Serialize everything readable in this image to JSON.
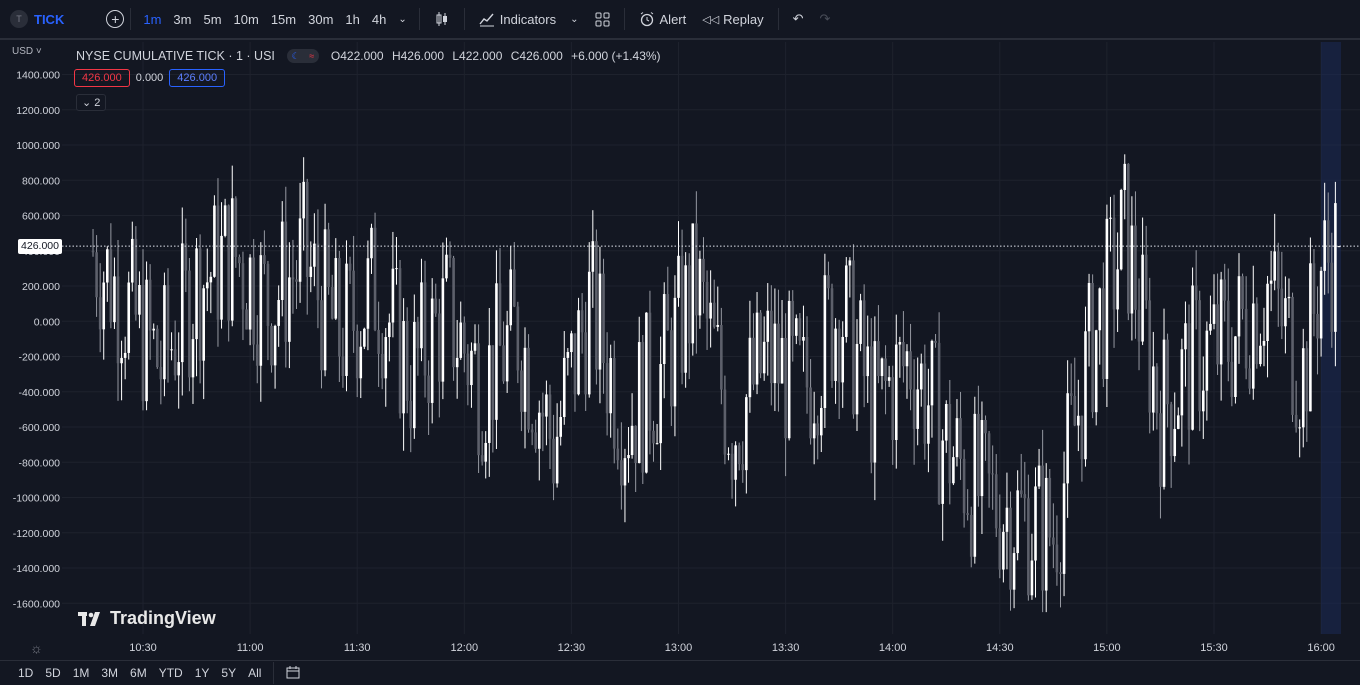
{
  "toolbar": {
    "symbol_badge": "T",
    "symbol": "TICK",
    "intervals": [
      "1m",
      "3m",
      "5m",
      "10m",
      "15m",
      "30m",
      "1h",
      "4h"
    ],
    "active_interval": "1m",
    "indicators_label": "Indicators",
    "alert_label": "Alert",
    "replay_label": "Replay"
  },
  "legend": {
    "title": "NYSE CUMULATIVE TICK · 1 · USI",
    "open": "O422.000",
    "high": "H426.000",
    "low": "L422.000",
    "close": "C426.000",
    "change": "+6.000 (+1.43%)",
    "bid": "426.000",
    "spread": "0.000",
    "ask": "426.000",
    "collapse": "2"
  },
  "price_axis": {
    "currency": "USD",
    "last_price": "426.000",
    "ticks": [
      "1400.000",
      "1200.000",
      "1000.000",
      "800.000",
      "600.000",
      "400.000",
      "200.000",
      "0.000",
      "-200.000",
      "-400.000",
      "-600.000",
      "-800.000",
      "-1000.000",
      "-1200.000",
      "-1400.000",
      "-1600.000"
    ]
  },
  "time_axis": {
    "ticks": [
      "10:30",
      "11:00",
      "11:30",
      "12:00",
      "12:30",
      "13:00",
      "13:30",
      "14:00",
      "14:30",
      "15:00",
      "15:30",
      "16:00"
    ]
  },
  "watermark": "TradingView",
  "ranges": [
    "1D",
    "5D",
    "1M",
    "3M",
    "6M",
    "YTD",
    "1Y",
    "5Y",
    "All"
  ],
  "colors": {
    "background": "#131722",
    "accent": "#2962ff",
    "grid": "#1e222d",
    "candle": "#ffffff",
    "red": "#f23645"
  },
  "chart_data": {
    "type": "candlestick",
    "title": "NYSE CUMULATIVE TICK · 1 · USI",
    "ylim": [
      -1700,
      1500
    ],
    "x_range": [
      "10:16",
      "16:05"
    ],
    "last_close": 426,
    "close_path": [
      [
        "10:16",
        400
      ],
      [
        "10:25",
        100
      ],
      [
        "10:35",
        -250
      ],
      [
        "10:45",
        200
      ],
      [
        "10:55",
        400
      ],
      [
        "11:05",
        100
      ],
      [
        "11:15",
        350
      ],
      [
        "11:25",
        -100
      ],
      [
        "11:35",
        200
      ],
      [
        "11:45",
        -300
      ],
      [
        "11:55",
        50
      ],
      [
        "12:05",
        -350
      ],
      [
        "12:15",
        -50
      ],
      [
        "12:25",
        -700
      ],
      [
        "12:35",
        100
      ],
      [
        "12:45",
        -550
      ],
      [
        "12:55",
        -300
      ],
      [
        "13:05",
        200
      ],
      [
        "13:15",
        -600
      ],
      [
        "13:25",
        -200
      ],
      [
        "13:35",
        -400
      ],
      [
        "13:45",
        100
      ],
      [
        "13:55",
        -500
      ],
      [
        "14:05",
        -200
      ],
      [
        "14:15",
        -700
      ],
      [
        "14:25",
        -1000
      ],
      [
        "14:35",
        -1100
      ],
      [
        "14:45",
        -1200
      ],
      [
        "14:55",
        -200
      ],
      [
        "15:05",
        500
      ],
      [
        "15:15",
        -500
      ],
      [
        "15:25",
        -200
      ],
      [
        "15:35",
        -100
      ],
      [
        "15:45",
        200
      ],
      [
        "15:55",
        -300
      ],
      [
        "16:00",
        300
      ],
      [
        "16:05",
        426
      ]
    ]
  }
}
